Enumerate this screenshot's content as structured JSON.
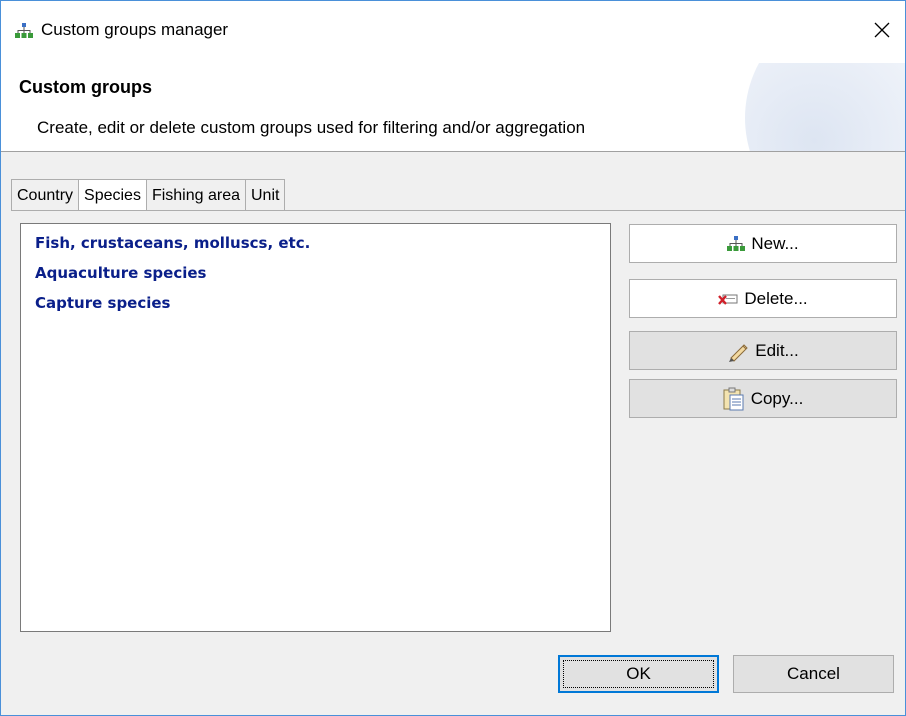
{
  "window": {
    "title": "Custom groups manager",
    "icon": "hierarchy-icon"
  },
  "header": {
    "heading": "Custom groups",
    "description": "Create, edit or delete custom groups used for filtering and/or aggregation"
  },
  "tabs": [
    {
      "label": "Country",
      "active": false
    },
    {
      "label": "Species",
      "active": true
    },
    {
      "label": "Fishing area",
      "active": false
    },
    {
      "label": "Unit",
      "active": false
    }
  ],
  "groups_list": {
    "items": [
      "Fish, crustaceans, molluscs, etc.",
      "Aquaculture species",
      "Capture species"
    ],
    "item_color": "#0a1f8a"
  },
  "actions": {
    "new_label": "New...",
    "delete_label": "Delete...",
    "edit_label": "Edit...",
    "copy_label": "Copy..."
  },
  "dialog_buttons": {
    "ok_label": "OK",
    "cancel_label": "Cancel"
  },
  "colors": {
    "accent": "#0078d7",
    "window_border": "#4a90d9"
  }
}
